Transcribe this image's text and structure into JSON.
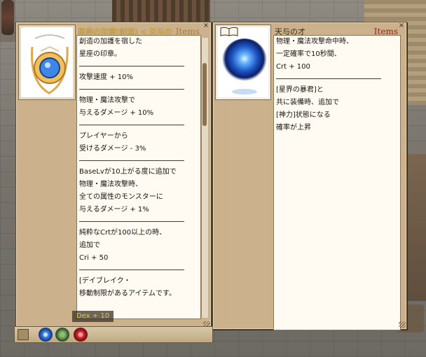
{
  "left_window": {
    "title": "星座の印章(創造) < 天与の",
    "items_label": "Items",
    "close_label": "×",
    "description_lines": [
      "創造の加護を宿した",
      "星座の印章。",
      "—",
      "攻撃速度 + 10%",
      "—",
      "物理・魔法攻撃で",
      "与えるダメージ + 10%",
      "—",
      "プレイヤーから",
      "受けるダメージ - 3%",
      "—",
      "BaseLvが10上がる度に追加で",
      "物理・魔法攻撃時、",
      "全ての属性のモンスターに",
      "与えるダメージ + 1%",
      "—",
      "純粋なCrtが100以上の時、",
      "追加で",
      "Cri + 50",
      "—",
      "[デイブレイク・",
      "移動制限があるアイテムです。"
    ]
  },
  "right_window": {
    "title": "天与の才",
    "items_label": "Items",
    "close_label": "×",
    "description_lines": [
      "物理・魔法攻撃命中時、",
      "一定確率で10秒間、",
      "Crt + 100",
      "—",
      "[星界の暴君]と",
      "共に装備時、追加で",
      "[神力]状態になる",
      "確率が上昇"
    ]
  },
  "hotbar": {
    "tooltip": "Dex + 10",
    "icons": [
      "blue-orb-icon",
      "green-plant-icon",
      "red-orb-icon"
    ]
  },
  "colors": {
    "panel_bg": "#cbb28c",
    "desc_bg": "#fffaf2",
    "items_red": "#8f2a20",
    "title_gold": "#e6b840"
  }
}
